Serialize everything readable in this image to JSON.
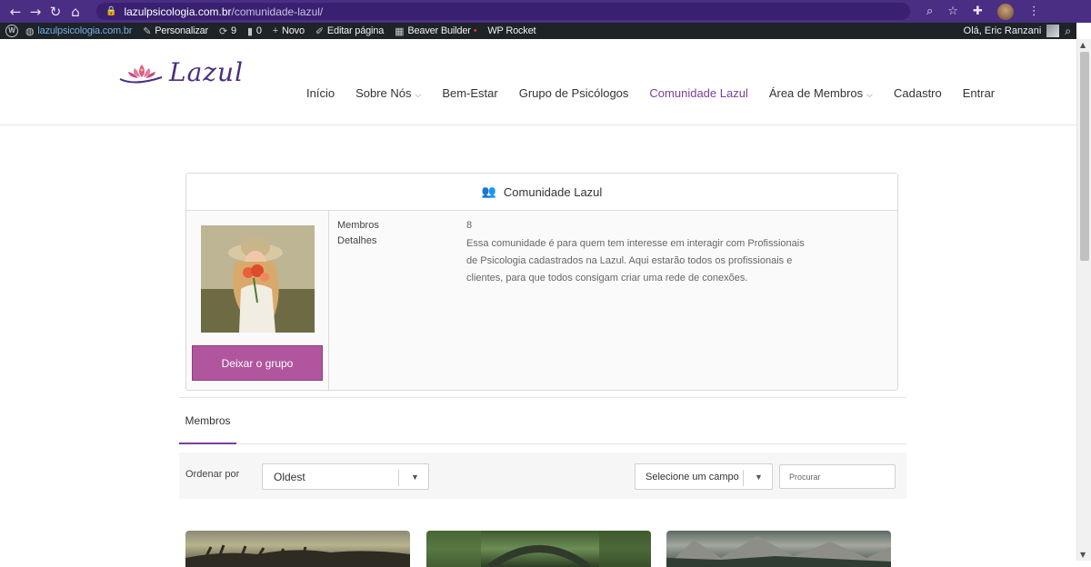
{
  "browser": {
    "url_host": "lazulpsicologia.com.br",
    "url_path": "/comunidade-lazul/"
  },
  "adminbar": {
    "site": "lazulpsicologia.com.br",
    "customize": "Personalizar",
    "updates": "9",
    "comments": "0",
    "new": "Novo",
    "edit": "Editar página",
    "beaver": "Beaver Builder",
    "rocket": "WP Rocket",
    "greeting": "Olá, Eric Ranzani"
  },
  "header": {
    "logo_text": "Lazul",
    "menu": [
      {
        "label": "Início",
        "has_dropdown": false
      },
      {
        "label": "Sobre Nós",
        "has_dropdown": true
      },
      {
        "label": "Bem-Estar",
        "has_dropdown": false
      },
      {
        "label": "Grupo de Psicólogos",
        "has_dropdown": false
      },
      {
        "label": "Comunidade Lazul",
        "has_dropdown": false,
        "active": true
      },
      {
        "label": "Área de Membros",
        "has_dropdown": true
      },
      {
        "label": "Cadastro",
        "has_dropdown": false
      },
      {
        "label": "Entrar",
        "has_dropdown": false
      }
    ]
  },
  "group": {
    "title": "Comunidade Lazul",
    "members_label": "Membros",
    "members_count": "8",
    "details_label": "Detalhes",
    "details_text": "Essa comunidade é para quem tem interesse em interagir com Profissionais de Psicologia cadastrados na Lazul. Aqui estarão todos os profissionais e clientes, para que todos consigam criar uma rede de conexões.",
    "leave_button": "Deixar o grupo"
  },
  "tabs": {
    "members": "Membros"
  },
  "filters": {
    "order_label": "Ordenar por",
    "order_value": "Oldest",
    "field_value": "Selecione um campo",
    "search_placeholder": "Procurar"
  },
  "colors": {
    "chrome": "#4a2e83",
    "accent": "#7b3f9a",
    "button": "#b0559e"
  }
}
